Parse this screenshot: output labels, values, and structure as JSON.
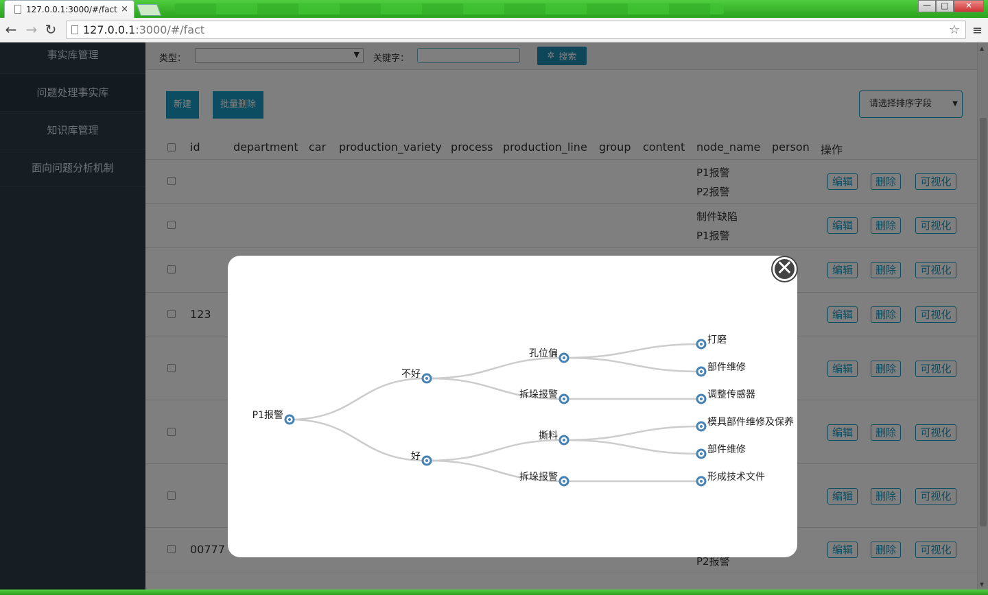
{
  "browser": {
    "tab_title": "127.0.0.1:3000/#/fact",
    "tab_close": "×",
    "url_host": "127.0.0.1",
    "url_rest": ":3000/#/fact",
    "win_min": "—",
    "win_max": "□",
    "win_close": "✕"
  },
  "sidebar": {
    "items": [
      {
        "label": "事实库管理"
      },
      {
        "label": "问题处理事实库"
      },
      {
        "label": "知识库管理"
      },
      {
        "label": "面向问题分析机制"
      }
    ]
  },
  "filter": {
    "type_label": "类型：",
    "keyword_label": "关键字：",
    "search_label": "搜索"
  },
  "actions": {
    "new_label": "新建",
    "batch_delete_label": "批量删除",
    "sort_placeholder": "请选择排序字段"
  },
  "table": {
    "headers": [
      "id",
      "department",
      "car",
      "production_variety",
      "process",
      "production_line",
      "group",
      "content",
      "node_name",
      "person",
      "操作"
    ],
    "ops": {
      "edit": "编辑",
      "delete": "删除",
      "visualize": "可视化"
    },
    "rows": [
      {
        "id": "",
        "node_names": [
          "P1报警",
          "P2报警"
        ]
      },
      {
        "id": "",
        "node_names": [
          "制件缺陷",
          "P1报警"
        ]
      },
      {
        "id": "",
        "node_names": []
      },
      {
        "id": "123",
        "node_names": []
      },
      {
        "id": "",
        "node_names": []
      },
      {
        "id": "",
        "node_names": []
      },
      {
        "id": "",
        "node_names": []
      },
      {
        "id": "00777",
        "node_names": [
          "P2报警"
        ]
      }
    ]
  },
  "modal": {
    "close_symbol": "✕",
    "tree": {
      "name": "P1报警",
      "children": [
        {
          "name": "不好",
          "children": [
            {
              "name": "孔位偏",
              "children": [
                {
                  "name": "打磨"
                },
                {
                  "name": "部件维修"
                }
              ]
            },
            {
              "name": "拆垛报警",
              "children": [
                {
                  "name": "调整传感器"
                }
              ]
            }
          ]
        },
        {
          "name": "好",
          "children": [
            {
              "name": "撕料",
              "children": [
                {
                  "name": "模具部件维修及保养"
                },
                {
                  "name": "部件维修"
                }
              ]
            },
            {
              "name": "拆垛报警",
              "children": [
                {
                  "name": "形成技术文件"
                }
              ]
            }
          ]
        }
      ]
    }
  }
}
